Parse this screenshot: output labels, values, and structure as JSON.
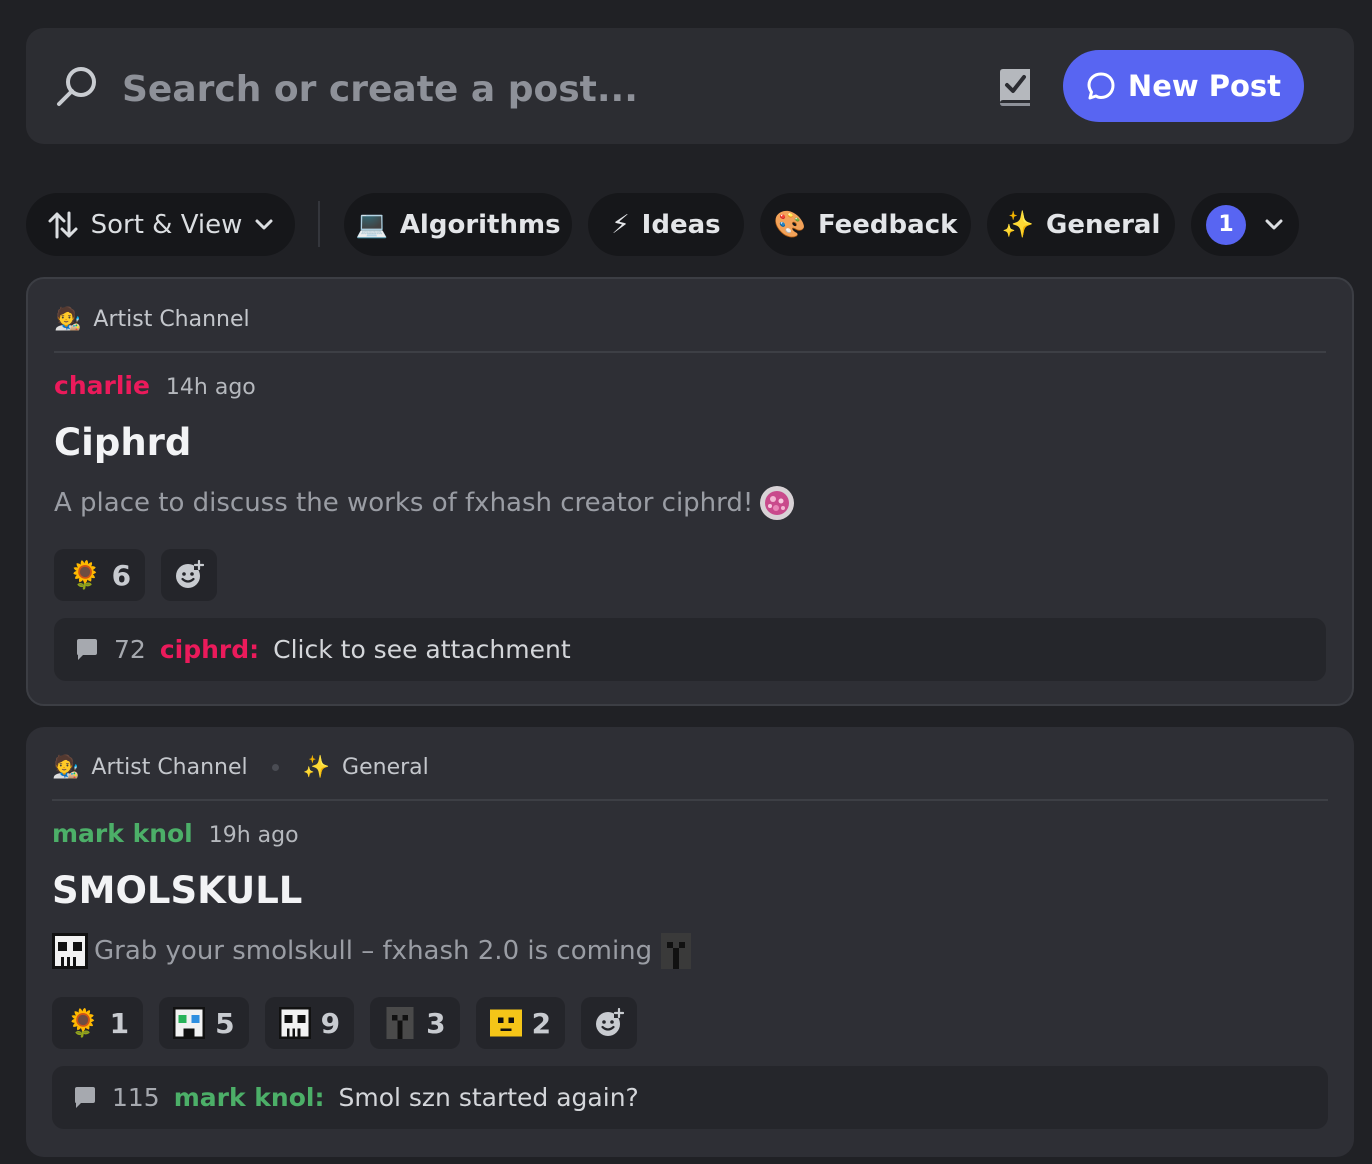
{
  "search": {
    "placeholder": "Search or create a post..."
  },
  "toolbar": {
    "new_post_label": "New Post"
  },
  "filters": {
    "sort_label": "Sort & View",
    "tags": [
      {
        "emoji": "💻",
        "label": "Algorithms"
      },
      {
        "emoji": "⚡",
        "label": "Ideas"
      },
      {
        "emoji": "🎨",
        "label": "Feedback"
      },
      {
        "emoji": "✨",
        "label": "General"
      }
    ],
    "more_count": "1"
  },
  "posts": [
    {
      "tags": [
        {
          "emoji": "🧑‍🎨",
          "label": "Artist Channel"
        }
      ],
      "author": "charlie",
      "author_color": "#eb1a5b",
      "time": "14h ago",
      "title": "Ciphrd",
      "snippet": "A place to discuss the works of fxhash creator ciphrd!",
      "reactions": [
        {
          "emoji": "🌻",
          "count": "6"
        }
      ],
      "message_count": "72",
      "last_author": "ciphrd:",
      "last_author_color": "#eb1a5b",
      "last_message": "Click to see attachment"
    },
    {
      "tags": [
        {
          "emoji": "🧑‍🎨",
          "label": "Artist Channel"
        },
        {
          "emoji": "✨",
          "label": "General"
        }
      ],
      "author": "mark knol",
      "author_color": "#4caf68",
      "time": "19h ago",
      "title": "SMOLSKULL",
      "snippet": "Grab your smolskull – fxhash 2.0 is coming",
      "reactions": [
        {
          "emoji": "🌻",
          "count": "1"
        },
        {
          "emoji": "smolskull-green",
          "count": "5"
        },
        {
          "emoji": "smolskull-white",
          "count": "9"
        },
        {
          "emoji": "smolskull-dark",
          "count": "3"
        },
        {
          "emoji": "smolskull-yellow",
          "count": "2"
        }
      ],
      "message_count": "115",
      "last_author": "mark knol:",
      "last_author_color": "#4caf68",
      "last_message": "Smol szn started again?"
    }
  ],
  "colors": {
    "accent": "#5865f2",
    "background": "#202125",
    "card": "#2e2f35"
  }
}
